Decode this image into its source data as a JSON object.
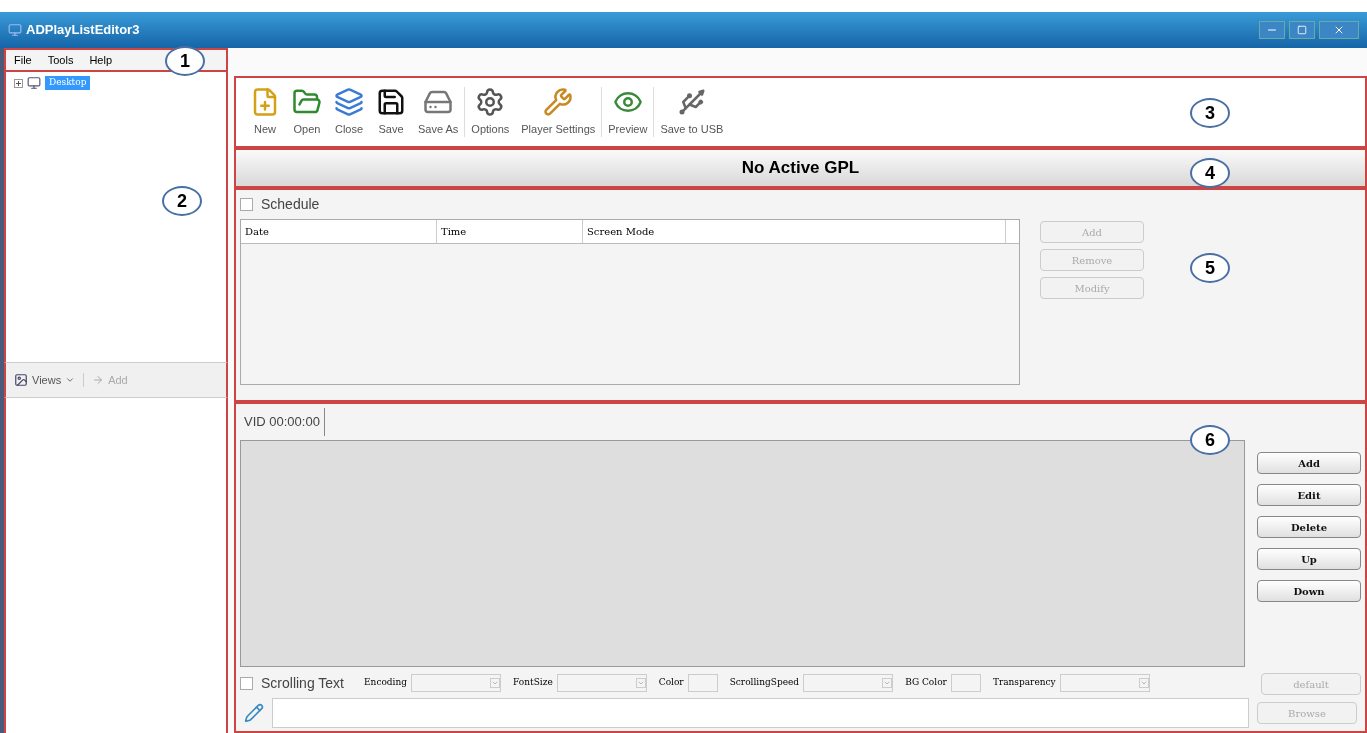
{
  "window": {
    "title": "ADPlayListEditor3"
  },
  "menu": [
    "File",
    "Tools",
    "Help"
  ],
  "tree": [
    {
      "label": "Desktop",
      "selected": true,
      "expanded": false
    }
  ],
  "views_bar": {
    "views": "Views",
    "add": "Add",
    "add_disabled": true
  },
  "toolbar": {
    "groups": [
      {
        "items": [
          {
            "kind": "new",
            "label": "New"
          },
          {
            "kind": "open",
            "label": "Open"
          },
          {
            "kind": "close",
            "label": "Close"
          },
          {
            "kind": "save",
            "label": "Save"
          },
          {
            "kind": "saveas",
            "label": "Save As"
          }
        ]
      },
      {
        "items": [
          {
            "kind": "options",
            "label": "Options"
          },
          {
            "kind": "player",
            "label": "Player Settings"
          }
        ]
      },
      {
        "items": [
          {
            "kind": "preview",
            "label": "Preview"
          }
        ]
      },
      {
        "items": [
          {
            "kind": "usb",
            "label": "Save to USB"
          }
        ]
      }
    ]
  },
  "header": "No Active GPL",
  "schedule": {
    "label": "Schedule",
    "checked": false,
    "columns": [
      "Date",
      "Time",
      "Screen Mode"
    ],
    "buttons": [
      {
        "label": "Add",
        "disabled": true
      },
      {
        "label": "Remove",
        "disabled": true
      },
      {
        "label": "Modify",
        "disabled": true
      }
    ]
  },
  "video": {
    "tab": "VID 00:00:00",
    "buttons": [
      {
        "label": "Add",
        "disabled": false
      },
      {
        "label": "Edit",
        "disabled": false
      },
      {
        "label": "Delete",
        "disabled": false
      },
      {
        "label": "Up",
        "disabled": false
      },
      {
        "label": "Down",
        "disabled": false
      }
    ]
  },
  "scrolling_text": {
    "label": "Scrolling Text",
    "checked": false,
    "controls": [
      {
        "kind": "dropdown",
        "label": "Encoding"
      },
      {
        "kind": "dropdown",
        "label": "FontSize"
      },
      {
        "kind": "color",
        "label": "Color"
      },
      {
        "kind": "dropdown",
        "label": "ScrollingSpeed"
      },
      {
        "kind": "color",
        "label": "BG Color"
      },
      {
        "kind": "dropdown",
        "label": "Transparency"
      }
    ],
    "buttons": [
      {
        "label": "default",
        "disabled": true
      },
      {
        "label": "Browse",
        "disabled": true
      }
    ]
  },
  "callouts": [
    "1",
    "2",
    "3",
    "4",
    "5",
    "6"
  ]
}
